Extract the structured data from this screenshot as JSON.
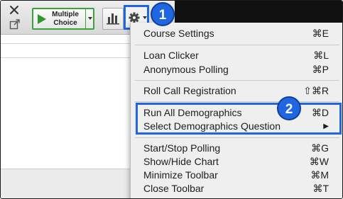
{
  "toolbar": {
    "poll_button": {
      "label_line1": "Multiple",
      "label_line2": "Choice"
    },
    "icons": [
      "close-icon",
      "external-window-icon",
      "play-icon",
      "chevron-down-icon",
      "bar-chart-icon",
      "gear-icon"
    ]
  },
  "badges": {
    "first": "1",
    "second": "2"
  },
  "menu": {
    "items": [
      {
        "label": "Course Settings",
        "shortcut": "⌘E"
      },
      {
        "label": "Loan Clicker",
        "shortcut": "⌘L"
      },
      {
        "label": "Anonymous Polling",
        "shortcut": "⌘P"
      },
      {
        "label": "Roll Call Registration",
        "shortcut": "⇧⌘R"
      },
      {
        "label": "Run All Demographics",
        "shortcut": "⌘D"
      },
      {
        "label": "Select Demographics Question",
        "shortcut": "▶"
      },
      {
        "label": "Start/Stop Polling",
        "shortcut": "⌘G"
      },
      {
        "label": "Show/Hide Chart",
        "shortcut": "⌘W"
      },
      {
        "label": "Minimize Toolbar",
        "shortcut": "⌘M"
      },
      {
        "label": "Close Toolbar",
        "shortcut": "⌘T"
      }
    ]
  },
  "colors": {
    "accent": "#1f66e0",
    "poll_green": "#2e9a2e",
    "menu_bg": "#efefef"
  }
}
